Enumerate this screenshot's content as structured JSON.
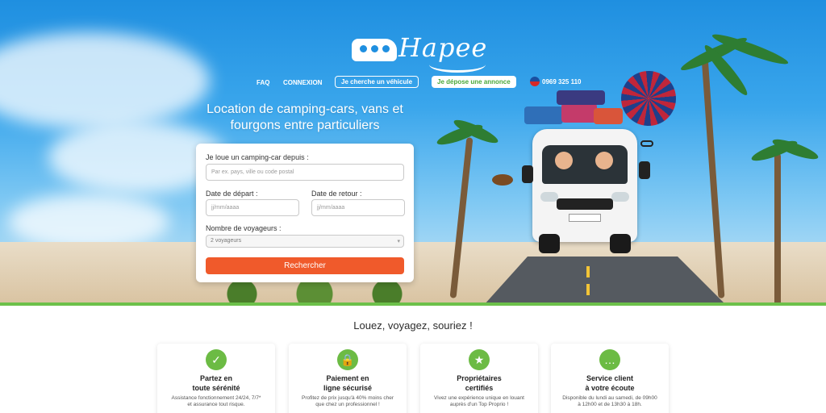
{
  "brand": {
    "logo_text": "Hapee"
  },
  "nav": {
    "faq": "FAQ",
    "login": "CONNEXION",
    "search_vehicle": "Je cherche un véhicule",
    "post_listing": "Je dépose une annonce",
    "phone": "0969 325 110"
  },
  "hero": {
    "headline_line1": "Location de camping-cars, vans et",
    "headline_line2": "fourgons entre particuliers"
  },
  "search": {
    "location_label": "Je loue un camping-car depuis :",
    "location_placeholder": "Par ex. pays, ville ou code postal",
    "departure_label": "Date de départ :",
    "departure_placeholder": "jj/mm/aaaa",
    "return_label": "Date de retour :",
    "return_placeholder": "jj/mm/aaaa",
    "travelers_label": "Nombre de voyageurs :",
    "travelers_value": "2 voyageurs",
    "submit": "Rechercher"
  },
  "features": {
    "tagline": "Louez, voyagez, souriez !",
    "cards": [
      {
        "icon": "shield-thumbs-up-icon",
        "title_1": "Partez en",
        "title_2": "toute sérénité",
        "desc": "Assistance fonctionnement 24/24, 7/7* et assurance tout risque."
      },
      {
        "icon": "padlock-check-icon",
        "title_1": "Paiement en",
        "title_2": "ligne sécurisé",
        "desc": "Profitez de prix jusqu'à 40% moins cher que chez un professionnel !"
      },
      {
        "icon": "star-badge-icon",
        "title_1": "Propriétaires",
        "title_2": "certifiés",
        "desc": "Vivez une expérience unique en louant auprès d'un Top Proprio !"
      },
      {
        "icon": "chat-bubbles-icon",
        "title_1": "Service client",
        "title_2": "à votre écoute",
        "desc": "Disponible du lundi au samedi, de 09h00 à 12h00 et de 13h30 à 18h."
      }
    ]
  },
  "colors": {
    "accent_green": "#6cbb44",
    "cta_orange": "#f05a2b"
  }
}
